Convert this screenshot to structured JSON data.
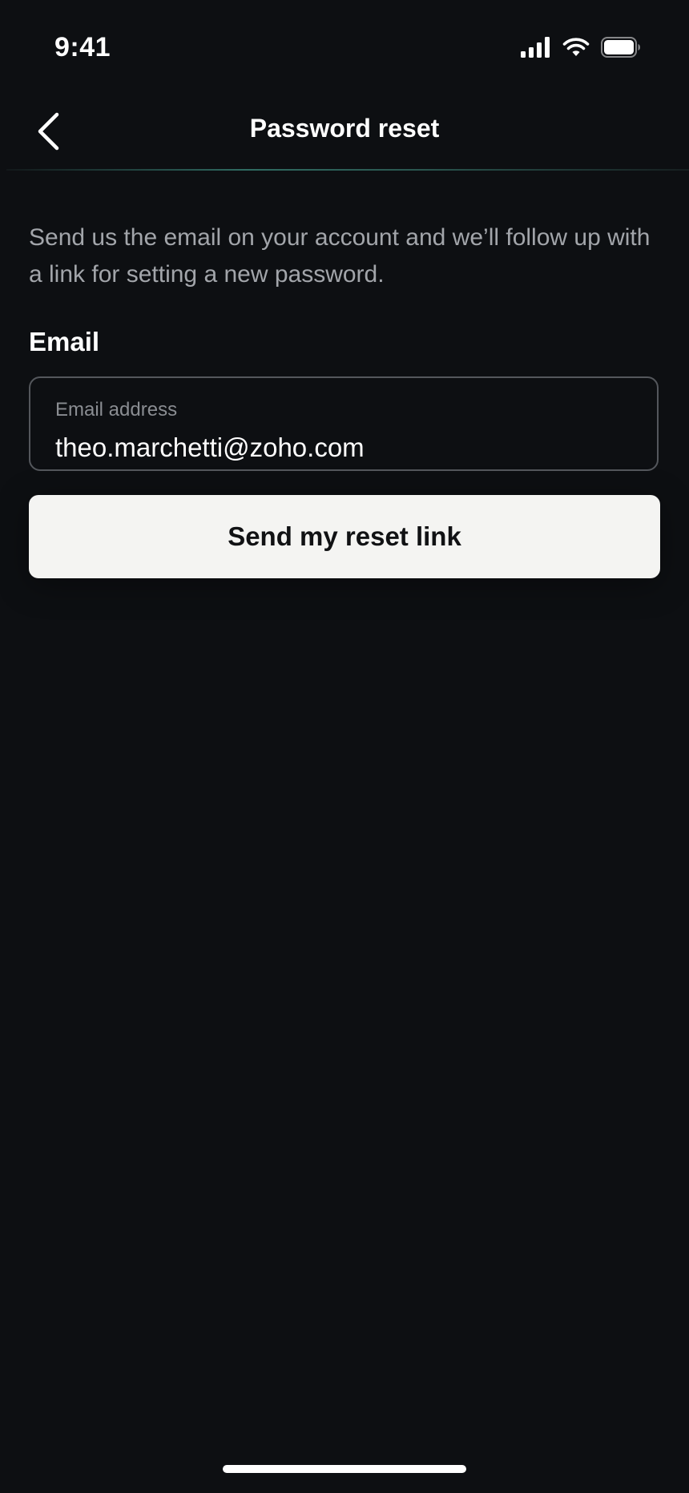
{
  "status_bar": {
    "time": "9:41",
    "icons": [
      "cellular-signal-icon",
      "wifi-icon",
      "battery-icon"
    ]
  },
  "nav": {
    "back_icon": "chevron-left-icon",
    "title": "Password reset"
  },
  "content": {
    "description": "Send us the email on your account and we’ll follow up with a link for setting a new password.",
    "email_label": "Email",
    "email_field": {
      "label": "Email address",
      "value": "theo.marchetti@zoho.com"
    },
    "submit_label": "Send my reset link"
  },
  "colors": {
    "background": "#0d0f12",
    "accent_divider": "#2f6b62",
    "button_bg": "#f4f4f2",
    "button_text": "#111214",
    "muted_text": "#a2a5aa"
  }
}
